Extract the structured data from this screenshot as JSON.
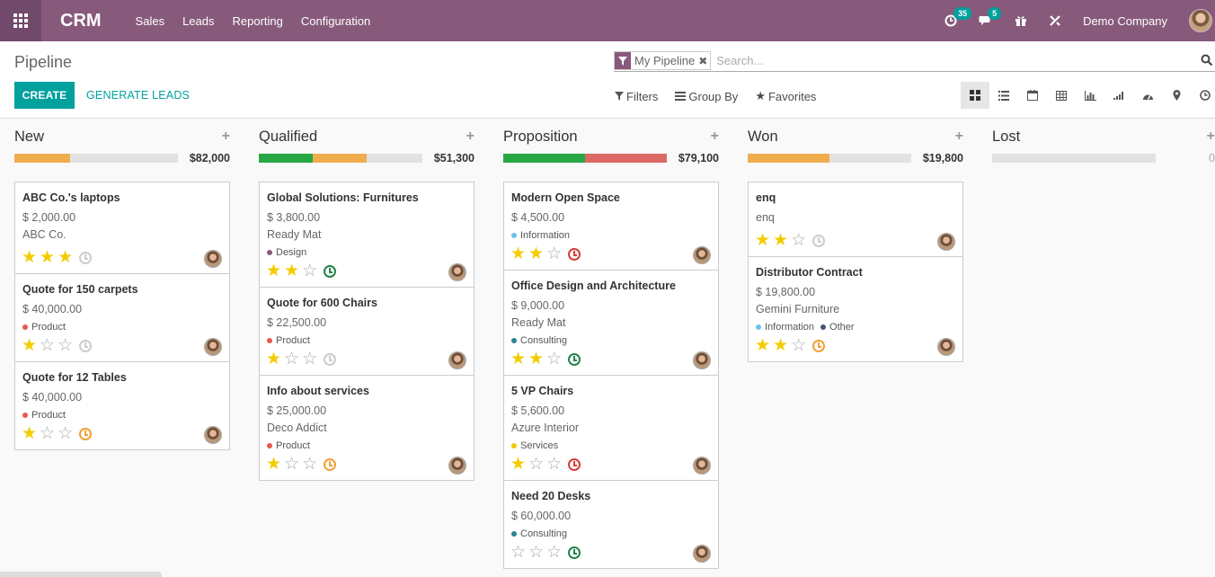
{
  "app": {
    "brand": "CRM",
    "menu": [
      "Sales",
      "Leads",
      "Reporting",
      "Configuration"
    ],
    "activity_count": "35",
    "message_count": "5",
    "company": "Demo Company"
  },
  "control": {
    "title": "Pipeline",
    "facet": "My Pipeline",
    "search_placeholder": "Search...",
    "create_label": "CREATE",
    "generate_label": "GENERATE LEADS",
    "filters_label": "Filters",
    "groupby_label": "Group By",
    "favorites_label": "Favorites"
  },
  "columns": [
    {
      "title": "New",
      "sum": "$82,000",
      "progress": [
        {
          "color": "#f0ad4e",
          "fraction": 0.34
        }
      ],
      "cards": [
        {
          "title": "ABC Co.'s laptops",
          "amount": "$ 2,000.00",
          "partner": "ABC Co.",
          "tags": [],
          "stars": 3,
          "activity": "none"
        },
        {
          "title": "Quote for 150 carpets",
          "amount": "$ 40,000.00",
          "partner": "",
          "tags": [
            {
              "name": "Product",
              "color": "#e9594d"
            }
          ],
          "stars": 1,
          "activity": "none"
        },
        {
          "title": "Quote for 12 Tables",
          "amount": "$ 40,000.00",
          "partner": "",
          "tags": [
            {
              "name": "Product",
              "color": "#e9594d"
            }
          ],
          "stars": 1,
          "activity": "today"
        }
      ]
    },
    {
      "title": "Qualified",
      "sum": "$51,300",
      "progress": [
        {
          "color": "#28a745",
          "fraction": 0.33
        },
        {
          "color": "#f0ad4e",
          "fraction": 0.33
        }
      ],
      "cards": [
        {
          "title": "Global Solutions: Furnitures",
          "amount": "$ 3,800.00",
          "partner": "Ready Mat",
          "tags": [
            {
              "name": "Design",
              "color": "#875a7b"
            }
          ],
          "stars": 2,
          "activity": "planned"
        },
        {
          "title": "Quote for 600 Chairs",
          "amount": "$ 22,500.00",
          "partner": "",
          "tags": [
            {
              "name": "Product",
              "color": "#e9594d"
            }
          ],
          "stars": 1,
          "activity": "none"
        },
        {
          "title": "Info about services",
          "amount": "$ 25,000.00",
          "partner": "Deco Addict",
          "tags": [
            {
              "name": "Product",
              "color": "#e9594d"
            }
          ],
          "stars": 1,
          "activity": "today"
        }
      ]
    },
    {
      "title": "Proposition",
      "sum": "$79,100",
      "progress": [
        {
          "color": "#28a745",
          "fraction": 0.5
        },
        {
          "color": "#dc6965",
          "fraction": 0.5
        }
      ],
      "cards": [
        {
          "title": "Modern Open Space",
          "amount": "$ 4,500.00",
          "partner": "",
          "tags": [
            {
              "name": "Information",
              "color": "#6cc1ed"
            }
          ],
          "stars": 2,
          "activity": "overdue"
        },
        {
          "title": "Office Design and Architecture",
          "amount": "$ 9,000.00",
          "partner": "Ready Mat",
          "tags": [
            {
              "name": "Consulting",
              "color": "#2c8397"
            }
          ],
          "stars": 2,
          "activity": "planned"
        },
        {
          "title": "5 VP Chairs",
          "amount": "$ 5,600.00",
          "partner": "Azure Interior",
          "tags": [
            {
              "name": "Services",
              "color": "#f4c609"
            }
          ],
          "stars": 1,
          "activity": "overdue"
        },
        {
          "title": "Need 20 Desks",
          "amount": "$ 60,000.00",
          "partner": "",
          "tags": [
            {
              "name": "Consulting",
              "color": "#2c8397"
            }
          ],
          "stars": 0,
          "activity": "planned"
        }
      ]
    },
    {
      "title": "Won",
      "sum": "$19,800",
      "progress": [
        {
          "color": "#f0ad4e",
          "fraction": 0.5
        }
      ],
      "cards": [
        {
          "title": "enq",
          "amount": "",
          "partner": "enq",
          "tags": [],
          "stars": 2,
          "activity": "none"
        },
        {
          "title": "Distributor Contract",
          "amount": "$ 19,800.00",
          "partner": "Gemini Furniture",
          "tags": [
            {
              "name": "Information",
              "color": "#6cc1ed"
            },
            {
              "name": "Other",
              "color": "#475577"
            }
          ],
          "stars": 2,
          "activity": "today"
        }
      ]
    },
    {
      "title": "Lost",
      "sum": "0",
      "progress": [],
      "cards": []
    }
  ]
}
